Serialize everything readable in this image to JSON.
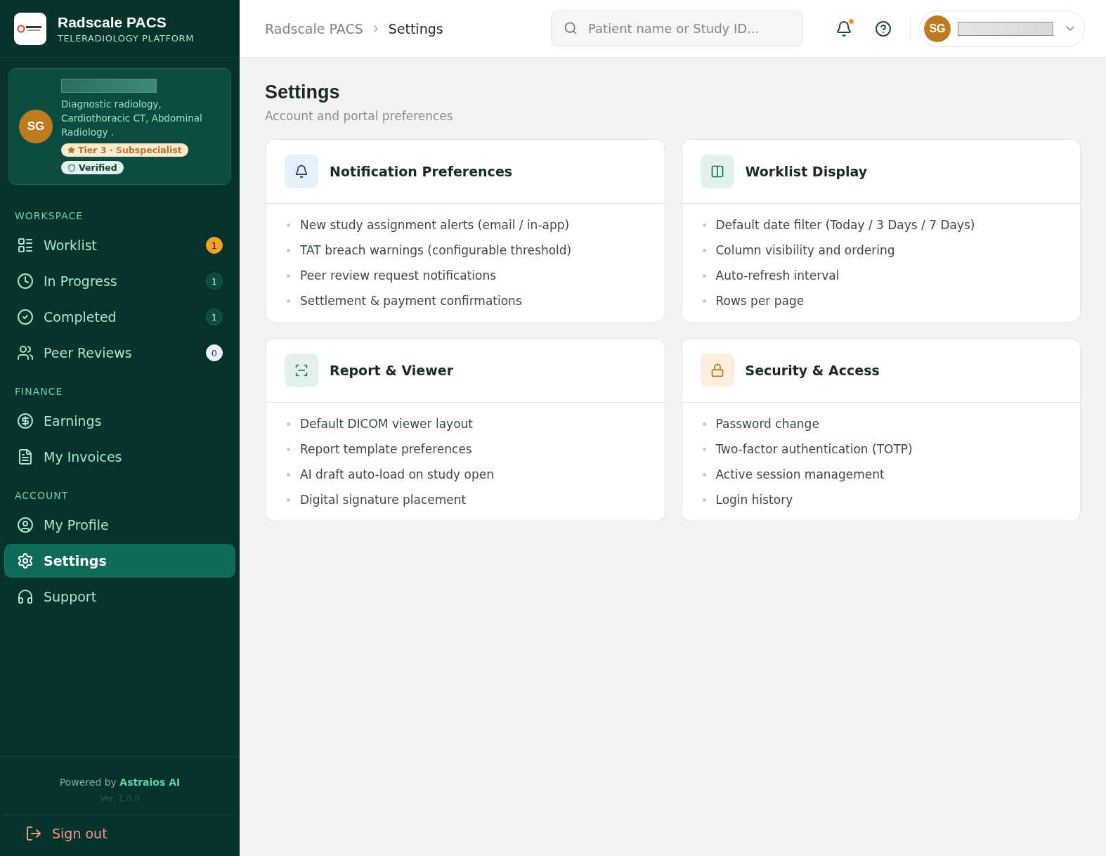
{
  "brand": {
    "title": "Radscale PACS",
    "subtitle": "TELERADIOLOGY PLATFORM"
  },
  "profile": {
    "initials": "SG",
    "specialties": "Diagnostic radiology, Cardiothoracic CT, Abdominal Radiology .",
    "tier": "Tier 3 · Subspecialist",
    "verified": "Verified"
  },
  "nav_sections": [
    {
      "title": "WORKSPACE",
      "items": [
        {
          "kind": "worklist",
          "label": "Worklist",
          "selected": false,
          "badge": {
            "text": "1",
            "kind": "alert"
          }
        },
        {
          "kind": "progress",
          "label": "In Progress",
          "selected": false,
          "badge": {
            "text": "1",
            "kind": "count"
          }
        },
        {
          "kind": "completed",
          "label": "Completed",
          "selected": false,
          "badge": {
            "text": "1",
            "kind": "count"
          }
        },
        {
          "kind": "peers",
          "label": "Peer Reviews",
          "selected": false,
          "badge": {
            "text": "0",
            "kind": "empty"
          }
        }
      ]
    },
    {
      "title": "FINANCE",
      "items": [
        {
          "kind": "earnings",
          "label": "Earnings",
          "selected": false
        },
        {
          "kind": "invoices",
          "label": "My Invoices",
          "selected": false
        }
      ]
    },
    {
      "title": "ACCOUNT",
      "items": [
        {
          "kind": "profile",
          "label": "My Profile",
          "selected": false
        },
        {
          "kind": "settings",
          "label": "Settings",
          "selected": true
        },
        {
          "kind": "support",
          "label": "Support",
          "selected": false
        }
      ]
    }
  ],
  "footer": {
    "powered_by": "Powered by **Astraios AI**",
    "version": "Ver. 1.0.0",
    "sign_out": "Sign out"
  },
  "breadcrumbs": [
    "Radscale PACS",
    "Settings"
  ],
  "search": {
    "placeholder": "Patient name or Study ID..."
  },
  "user_menu": {
    "initials": "SG"
  },
  "notifications_unread": true,
  "page": {
    "title": "Settings",
    "subtitle": "Account and portal preferences"
  },
  "cards": [
    {
      "kind": "notifications",
      "title": "Notification Preferences",
      "items": [
        "New study assignment alerts (email / in-app)",
        "TAT breach warnings (configurable threshold)",
        "Peer review request notifications",
        "Settlement & payment confirmations"
      ]
    },
    {
      "kind": "display",
      "title": "Worklist Display",
      "items": [
        "Default date filter (Today / 3 Days / 7 Days)",
        "Column visibility and ordering",
        "Auto-refresh interval",
        "Rows per page"
      ]
    },
    {
      "kind": "report",
      "title": "Report & Viewer",
      "items": [
        "Default DICOM viewer layout",
        "Report template preferences",
        "AI draft auto-load on study open",
        "Digital signature placement"
      ]
    },
    {
      "kind": "security",
      "title": "Security & Access",
      "items": [
        "Password change",
        "Two-factor authentication (TOTP)",
        "Active session management",
        "Login history"
      ]
    }
  ]
}
